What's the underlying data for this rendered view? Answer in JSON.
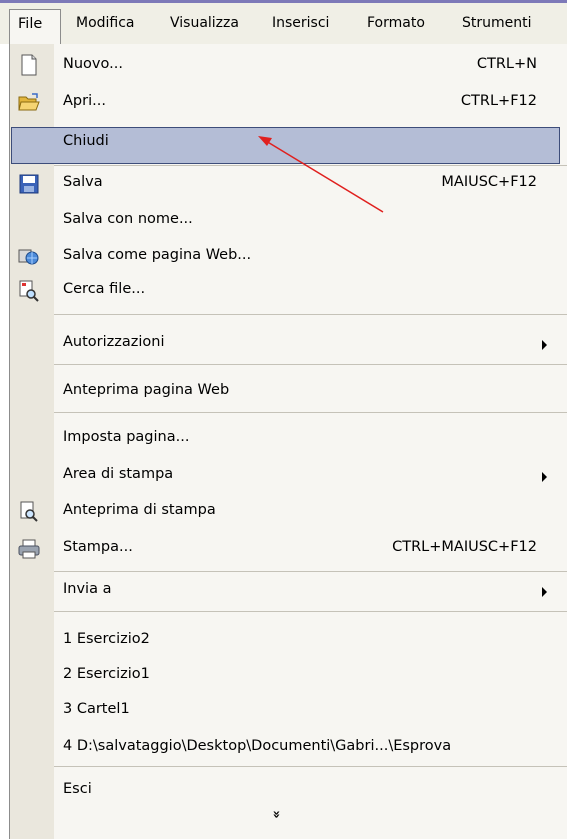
{
  "menubar": {
    "file": "File",
    "modifica": "Modifica",
    "visualizza": "Visualizza",
    "inserisci": "Inserisci",
    "formato": "Formato",
    "strumenti": "Strumenti"
  },
  "menu": {
    "nuovo": {
      "label": "Nuovo...",
      "shortcut": "CTRL+N"
    },
    "apri": {
      "label": "Apri...",
      "shortcut": "CTRL+F12"
    },
    "chiudi": {
      "label": "Chiudi"
    },
    "salva": {
      "label": "Salva",
      "shortcut": "MAIUSC+F12"
    },
    "salva_con_nome": {
      "label": "Salva con nome..."
    },
    "salva_web": {
      "label": "Salva come pagina Web..."
    },
    "cerca_file": {
      "label": "Cerca file..."
    },
    "autorizzazioni": {
      "label": "Autorizzazioni"
    },
    "anteprima_web": {
      "label": "Anteprima pagina Web"
    },
    "imposta_pagina": {
      "label": "Imposta pagina..."
    },
    "area_stampa": {
      "label": "Area di stampa"
    },
    "anteprima_stampa": {
      "label": "Anteprima di stampa"
    },
    "stampa": {
      "label": "Stampa...",
      "shortcut": "CTRL+MAIUSC+F12"
    },
    "invia_a": {
      "label": "Invia a"
    },
    "recent1": {
      "label": "1 Esercizio2"
    },
    "recent2": {
      "label": "2 Esercizio1"
    },
    "recent3": {
      "label": "3 Cartel1"
    },
    "recent4": {
      "label": "4 D:\\salvataggio\\Desktop\\Documenti\\Gabri...\\Esprova"
    },
    "esci": {
      "label": "Esci"
    },
    "expand": "»"
  },
  "colors": {
    "highlight": "#b4bdd6",
    "highlight_border": "#3d4d7a",
    "annotation_arrow": "#e0201e",
    "menu_bg": "#f7f6f2",
    "icon_column": "#eae7dd"
  }
}
